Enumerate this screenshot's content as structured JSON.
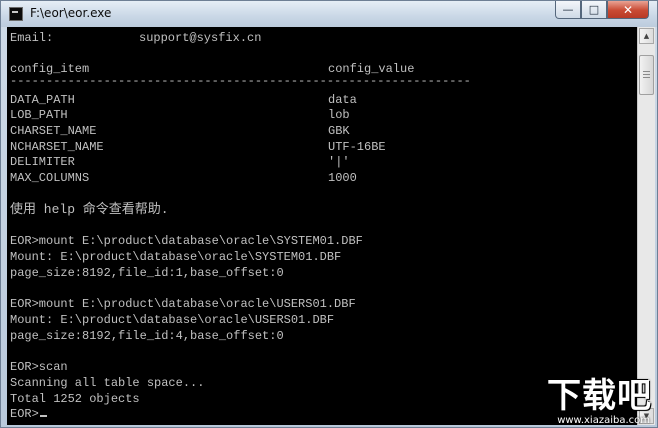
{
  "window": {
    "title": "F:\\eor\\eor.exe",
    "controls": {
      "minimize": "—",
      "maximize": "□",
      "close": "✕"
    }
  },
  "console": {
    "email_label": "Email:",
    "email_value": "support@sysfix.cn",
    "config_header": {
      "item": "config_item",
      "value": "config_value"
    },
    "separator": "----------------------------------------------------------------",
    "config_rows": [
      {
        "item": "DATA_PATH",
        "value": "data"
      },
      {
        "item": "LOB_PATH",
        "value": "lob"
      },
      {
        "item": "CHARSET_NAME",
        "value": "GBK"
      },
      {
        "item": "NCHARSET_NAME",
        "value": "UTF-16BE"
      },
      {
        "item": "DELIMITER",
        "value": "'|'"
      },
      {
        "item": "MAX_COLUMNS",
        "value": "1000"
      }
    ],
    "help_hint": "使用 help 命令查看帮助.",
    "session": [
      "EOR>mount E:\\product\\database\\oracle\\SYSTEM01.DBF",
      "Mount: E:\\product\\database\\oracle\\SYSTEM01.DBF",
      "page_size:8192,file_id:1,base_offset:0",
      "EOR>mount E:\\product\\database\\oracle\\USERS01.DBF",
      "Mount: E:\\product\\database\\oracle\\USERS01.DBF",
      "page_size:8192,file_id:4,base_offset:0",
      "EOR>scan",
      "Scanning all table space...",
      "Total 1252 objects"
    ],
    "prompt": "EOR>"
  },
  "watermark": {
    "text": "下载吧",
    "domain": "www.xiazaiba.com"
  }
}
